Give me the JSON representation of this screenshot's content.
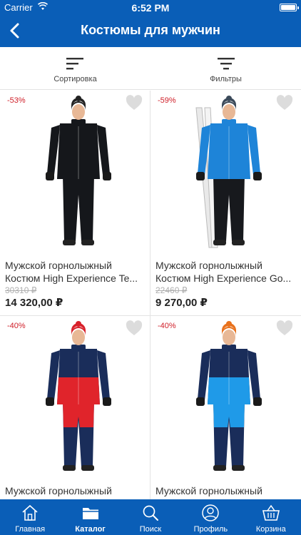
{
  "status_bar": {
    "carrier": "Carrier",
    "time": "6:52 PM"
  },
  "nav": {
    "title": "Костюмы для мужчин",
    "back_icon": "chevron-left-icon"
  },
  "toolbar": {
    "sort_label": "Сортировка",
    "filter_label": "Фильтры"
  },
  "products": [
    {
      "discount": "-53%",
      "name_line1": "Мужской горнолыжный",
      "name_line2": "Костюм High Experience Te...",
      "old_price": "30310 ₽",
      "price": "14 320,00 ₽",
      "jacket_color": "#15171b",
      "accent_color": "#2a2d33",
      "pants_color": "#15171b",
      "hat_color": "#222222"
    },
    {
      "discount": "-59%",
      "name_line1": "Мужской горнолыжный",
      "name_line2": "Костюм High Experience Go...",
      "old_price": "22460 ₽",
      "price": "9 270,00 ₽",
      "jacket_color": "#1e84d8",
      "accent_color": "#0f5fa8",
      "pants_color": "#17191d",
      "hat_color": "#3b4a5a"
    },
    {
      "discount": "-40%",
      "name_line1": "Мужской горнолыжный",
      "name_line2": "",
      "old_price": "",
      "price": "",
      "jacket_color": "#1a2d5a",
      "accent_color": "#e0242b",
      "pants_color": "#1a2d5a",
      "hat_color": "#d8202a"
    },
    {
      "discount": "-40%",
      "name_line1": "Мужской горнолыжный",
      "name_line2": "",
      "old_price": "",
      "price": "",
      "jacket_color": "#1a2d5a",
      "accent_color": "#1f9ae8",
      "pants_color": "#1a2d5a",
      "hat_color": "#e8711c"
    }
  ],
  "tabbar": {
    "items": [
      {
        "label": "Главная",
        "icon": "home-icon"
      },
      {
        "label": "Каталог",
        "icon": "folder-icon"
      },
      {
        "label": "Поиск",
        "icon": "search-icon"
      },
      {
        "label": "Профиль",
        "icon": "profile-icon"
      },
      {
        "label": "Корзина",
        "icon": "basket-icon"
      }
    ],
    "active_index": 1
  },
  "colors": {
    "brand_blue": "#0a5eb7",
    "discount_red": "#d0202a"
  }
}
